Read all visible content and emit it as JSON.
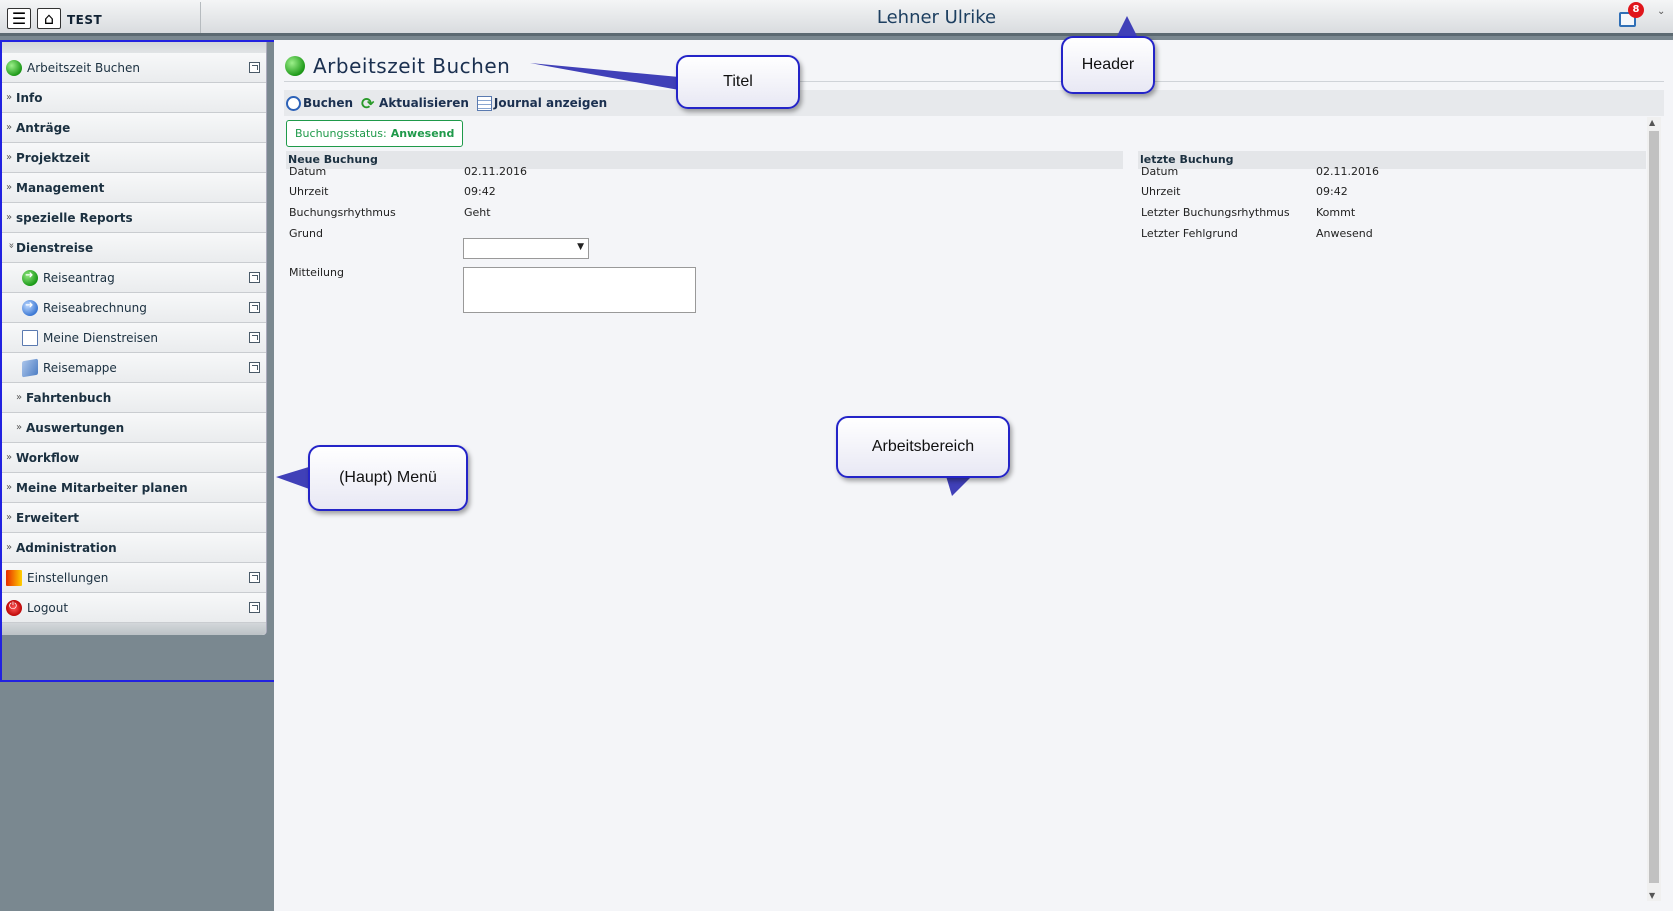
{
  "header": {
    "env_label": "TEST",
    "user_name": "Lehner Ulrike",
    "notification_count": "8"
  },
  "menu": {
    "items": [
      {
        "label": "Arbeitszeit Buchen"
      },
      {
        "label": "Info"
      },
      {
        "label": "Anträge"
      },
      {
        "label": "Projektzeit"
      },
      {
        "label": "Management"
      },
      {
        "label": "spezielle Reports"
      },
      {
        "label": "Dienstreise"
      },
      {
        "label": "Reiseantrag"
      },
      {
        "label": "Reiseabrechnung"
      },
      {
        "label": "Meine Dienstreisen"
      },
      {
        "label": "Reisemappe"
      },
      {
        "label": "Fahrtenbuch"
      },
      {
        "label": "Auswertungen"
      },
      {
        "label": "Workflow"
      },
      {
        "label": "Meine Mitarbeiter planen"
      },
      {
        "label": "Erweitert"
      },
      {
        "label": "Administration"
      },
      {
        "label": "Einstellungen"
      },
      {
        "label": "Logout"
      }
    ]
  },
  "main": {
    "title": "Arbeitszeit Buchen",
    "toolbar": {
      "book": "Buchen",
      "refresh": "Aktualisieren",
      "journal": "Journal anzeigen"
    },
    "status": {
      "label": "Buchungsstatus:",
      "value": "Anwesend"
    },
    "new_booking": {
      "header": "Neue Buchung",
      "datum_label": "Datum",
      "datum": "02.11.2016",
      "uhrzeit_label": "Uhrzeit",
      "uhrzeit": "09:42",
      "rhythmus_label": "Buchungsrhythmus",
      "rhythmus": "Geht",
      "grund_label": "Grund",
      "mitteilung_label": "Mitteilung"
    },
    "last_booking": {
      "header": "letzte Buchung",
      "datum_label": "Datum",
      "datum": "02.11.2016",
      "uhrzeit_label": "Uhrzeit",
      "uhrzeit": "09:42",
      "rhythmus_label": "Letzter Buchungsrhythmus",
      "rhythmus": "Kommt",
      "fehlgrund_label": "Letzter Fehlgrund",
      "fehlgrund": "Anwesend"
    }
  },
  "callouts": {
    "titel": "Titel",
    "header": "Header",
    "menu": "(Haupt) Menü",
    "work": "Arbeitsbereich"
  },
  "colors": {
    "accent_blue": "#2121e0",
    "status_green": "#1f9a4a",
    "header_dark": "#5c6a72"
  }
}
